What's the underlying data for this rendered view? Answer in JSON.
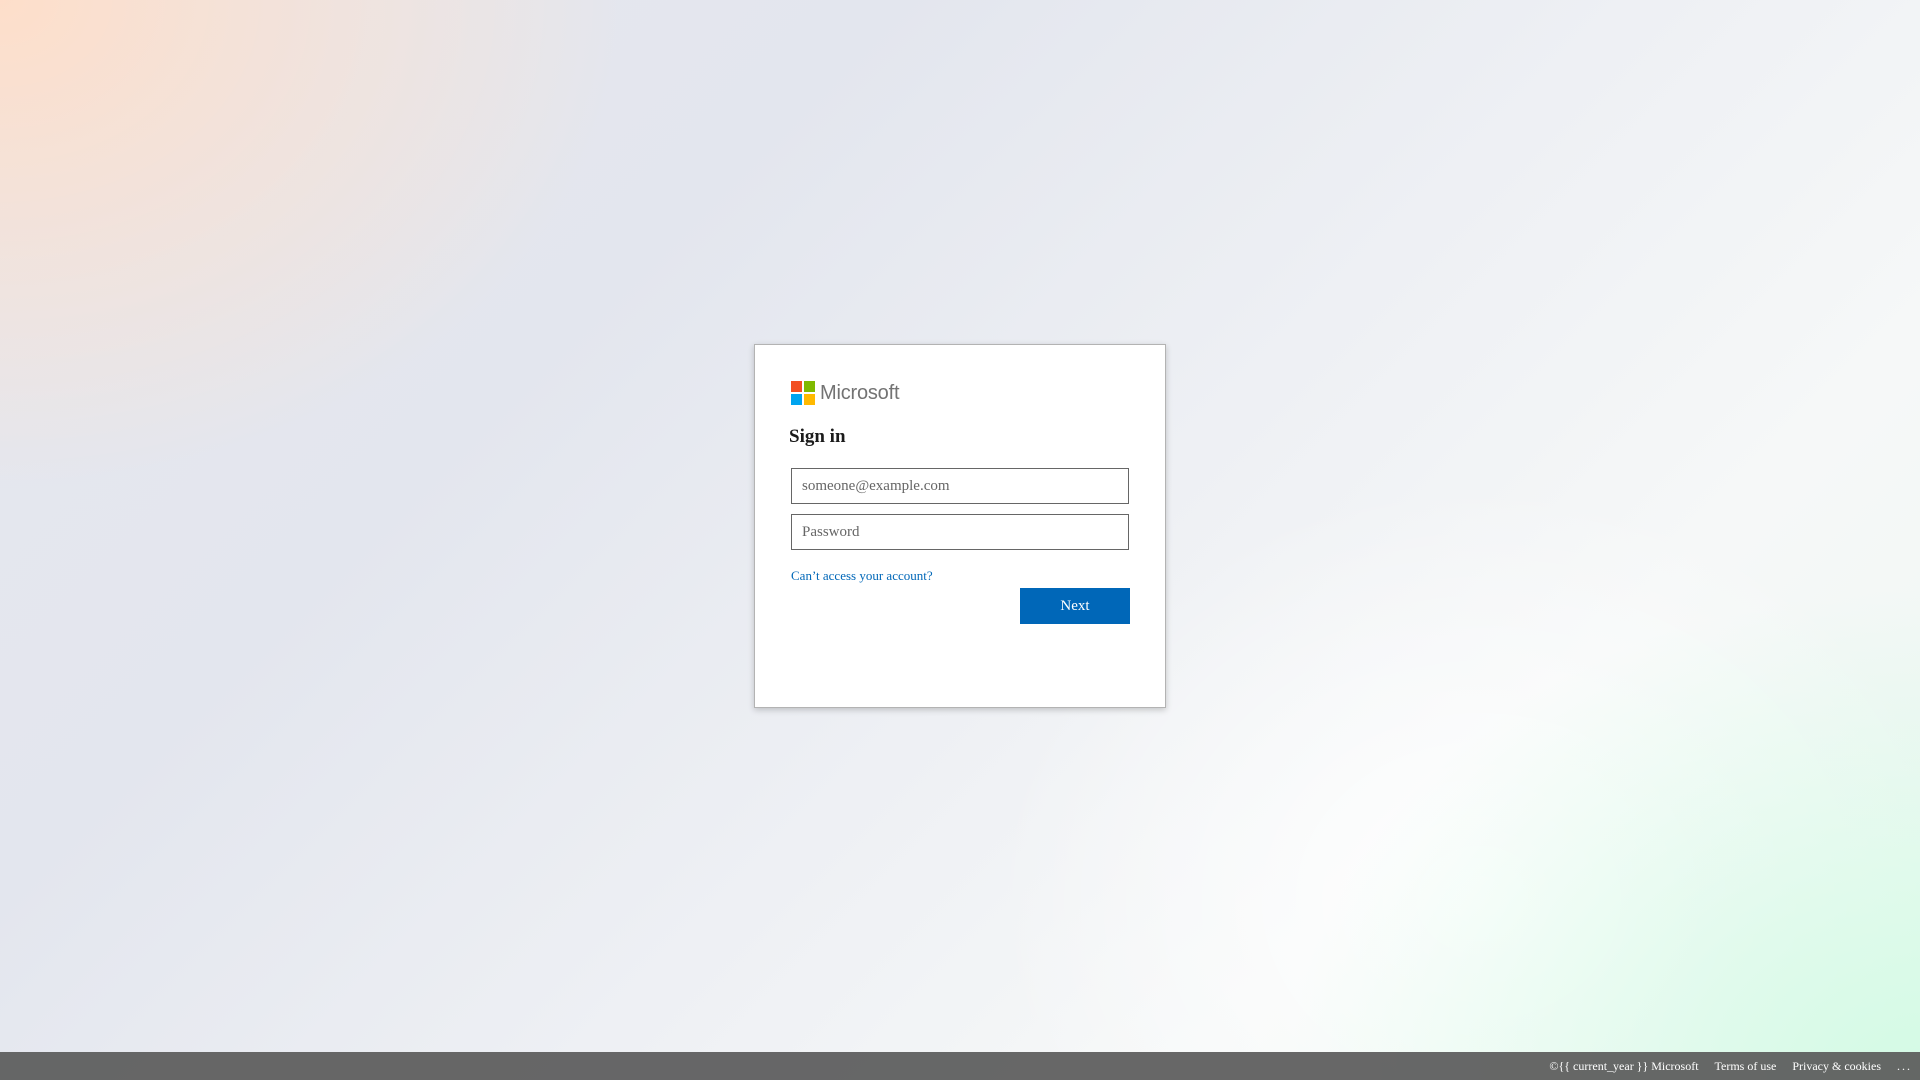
{
  "brand": {
    "name": "Microsoft",
    "colors": {
      "red": "#f25022",
      "green": "#7fba00",
      "blue": "#00a4ef",
      "yellow": "#ffb900",
      "accent": "#0067b8"
    }
  },
  "signin": {
    "title": "Sign in",
    "email_placeholder": "someone@example.com",
    "password_placeholder": "Password",
    "cant_access_link": "Can’t access your account?",
    "next_label": "Next"
  },
  "footer": {
    "copyright": "©{{ current_year }} Microsoft",
    "terms": "Terms of use",
    "privacy": "Privacy & cookies",
    "more": "..."
  }
}
